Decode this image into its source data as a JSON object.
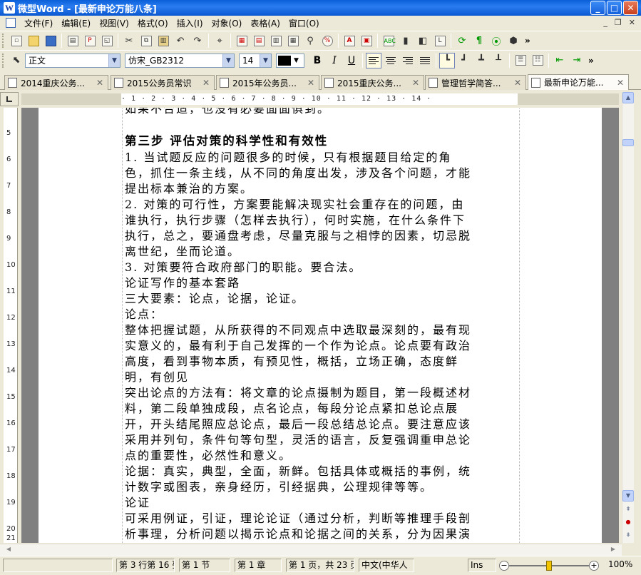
{
  "window": {
    "app_icon": "W",
    "title": "微型Word - [最新申论万能八条]"
  },
  "menu": {
    "items": [
      "文件(F)",
      "编辑(E)",
      "视图(V)",
      "格式(O)",
      "插入(I)",
      "对象(O)",
      "表格(A)",
      "窗口(O)"
    ]
  },
  "format_bar": {
    "style": "正文",
    "font": "仿宋_GB2312",
    "size": "14",
    "bold": "B",
    "italic": "I",
    "underline": "U"
  },
  "tabs": [
    {
      "label": "2014重庆公务..."
    },
    {
      "label": "2015公务员常识"
    },
    {
      "label": "2015年公务员..."
    },
    {
      "label": "2015重庆公务..."
    },
    {
      "label": "管理哲学简答..."
    },
    {
      "label": "最新申论万能..."
    }
  ],
  "ruler": {
    "marks": "· 1 · 2 · 3 · 4 · 5 · 6 · 7 · 8 · 9 · 10 · 11 · 12 · 13 · 14 ·",
    "vertical": [
      "5",
      "6",
      "7",
      "8",
      "9",
      "10",
      "11",
      "12",
      "13",
      "14",
      "15",
      "16",
      "17",
      "18",
      "19",
      "20",
      "21"
    ]
  },
  "document": {
    "lines": [
      "如果不合适，也没有必要面面俱到。",
      "",
      "第三步 评估对策的科学性和有效性",
      "1.  当试题反应的问题很多的时候，只有根据题目给定的角",
      "色，抓住一条主线，从不同的角度出发，涉及各个问题，才能",
      "提出标本兼治的方案。",
      "2.  对策的可行性，方案要能解决现实社会重存在的问题，由",
      "谁执行，执行步骤（怎样去执行），何时实施，在什么条件下",
      "执行，总之，要通盘考虑，尽量克服与之相悖的因素，切忌脱",
      "离世纪，坐而论道。",
      "3.  对策要符合政府部门的职能。要合法。",
      "论证写作的基本套路",
      "三大要素：论点，论据，论证。",
      "论点：",
      "整体把握试题，从所获得的不同观点中选取最深刻的，最有现",
      "实意义的，最有利于自己发挥的一个作为论点。论点要有政治",
      "高度，看到事物本质，有预见性，概括，立场正确，态度鲜",
      "明，有创见",
      "突出论点的方法有：将文章的论点摄制为题目，第一段概述材",
      "料，第二段单独成段，点名论点，每段分论点紧扣总论点展",
      "开，开头结尾照应总论点，最后一段总结总论点。要注意应该",
      "采用并列句，条件句等句型，灵活的语言，反复强调重申总论",
      "点的重要性，必然性和意义。",
      "论据：真实，典型，全面，新鲜。包括具体或概括的事例，统",
      "计数字或图表，亲身经历，引经据典，公理规律等等。",
      "论证",
      "可采用例证，引证，理论论证（通过分析，判断等推理手段剖",
      "析事理，分析问题以揭示论点和论据之间的关系，分为因果演"
    ]
  },
  "status": {
    "cell0": "",
    "position": "第 3 行第 16 列",
    "section": "第 1 节",
    "chapter": "第 1 章",
    "pages": "第 1 页，共 23 页",
    "language": "中文(中华人",
    "mode": "Ins",
    "zoom": "100%"
  }
}
